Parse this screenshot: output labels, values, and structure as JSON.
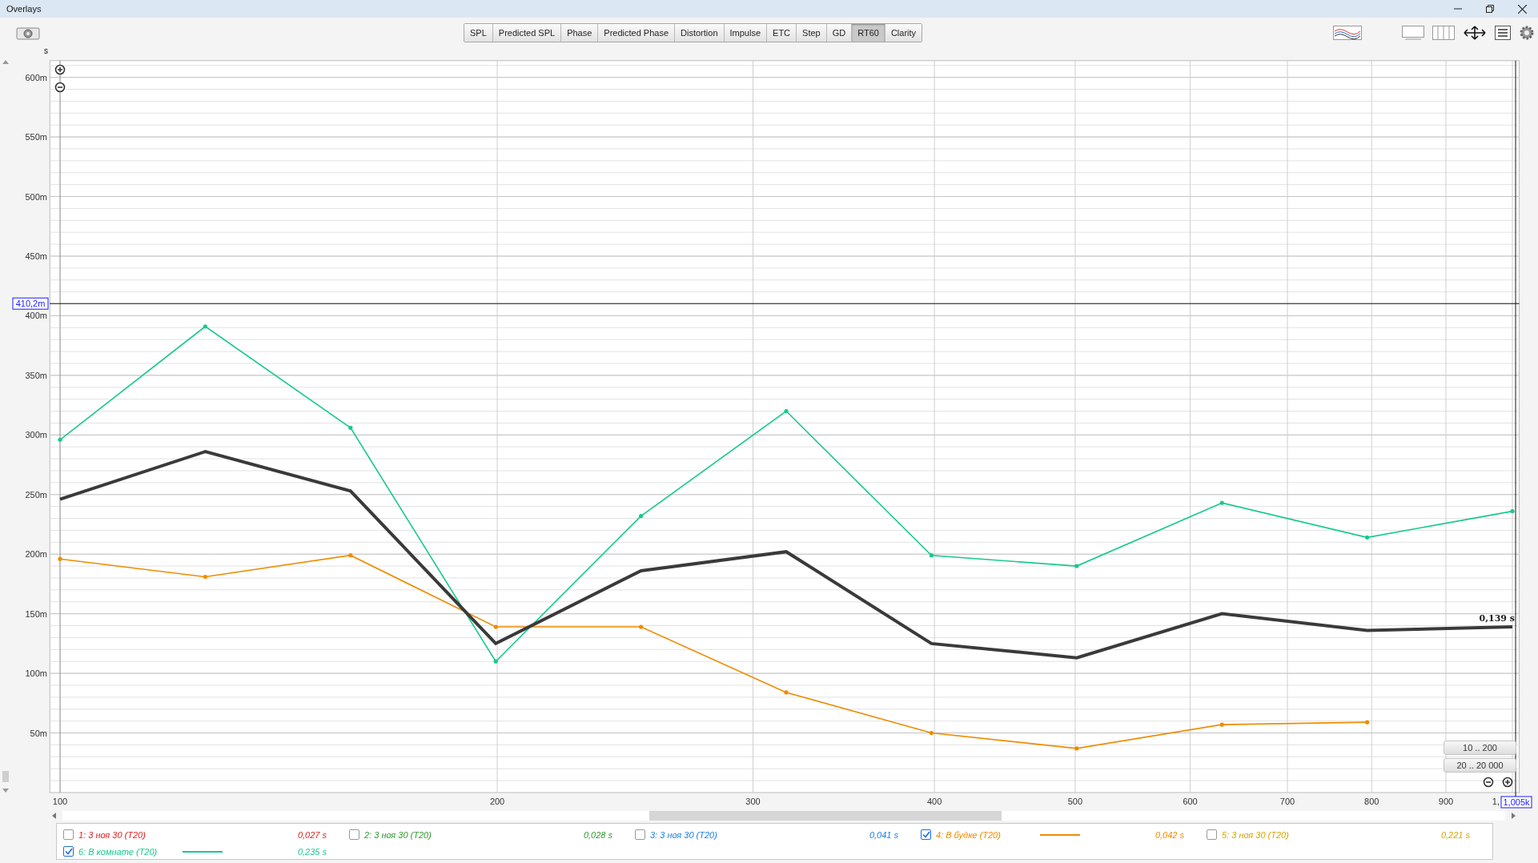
{
  "window": {
    "title": "Overlays"
  },
  "toolbar": {
    "tabs": [
      {
        "label": "SPL",
        "selected": false
      },
      {
        "label": "Predicted SPL",
        "selected": false
      },
      {
        "label": "Phase",
        "selected": false
      },
      {
        "label": "Predicted Phase",
        "selected": false
      },
      {
        "label": "Distortion",
        "selected": false
      },
      {
        "label": "Impulse",
        "selected": false
      },
      {
        "label": "ETC",
        "selected": false
      },
      {
        "label": "Step",
        "selected": false
      },
      {
        "label": "GD",
        "selected": false
      },
      {
        "label": "RT60",
        "selected": true
      },
      {
        "label": "Clarity",
        "selected": false
      }
    ]
  },
  "chart": {
    "unit_label": "s",
    "cursor_y_reading": "410,2m",
    "cursor_x_reading": "1,005k",
    "partial_x_label": "1,",
    "cursor_value": "0,139 s",
    "range_buttons": [
      "10 .. 200",
      "20 .. 20 000"
    ],
    "x_axis_labels": [
      "100",
      "200",
      "300",
      "400",
      "500",
      "600",
      "700",
      "800",
      "900"
    ],
    "chart_data": {
      "type": "line",
      "categories": [
        null,
        null,
        null,
        null,
        null,
        null,
        null,
        null,
        null,
        null,
        null
      ],
      "series": [
        {
          "color": "#17c98f",
          "values": [
            296,
            391,
            306,
            110,
            232,
            320,
            199,
            190,
            243,
            214,
            236
          ]
        },
        {
          "color": "#ef8c00",
          "values": [
            196,
            181,
            199,
            139,
            139,
            84,
            50,
            37,
            57,
            59,
            null
          ]
        },
        {
          "color": "#3a3a3a",
          "values": [
            246,
            286,
            253,
            125,
            186,
            202,
            125,
            113,
            150,
            136,
            139
          ]
        }
      ],
      "ylim": [
        0,
        614
      ],
      "grid": true,
      "ref_lines": [
        {
          "axis": "y",
          "value": 410.2
        }
      ],
      "yticks": [
        {
          "value": 50,
          "label": "50m"
        },
        {
          "value": 100,
          "label": "100m"
        },
        {
          "value": 150,
          "label": "150m"
        },
        {
          "value": 200,
          "label": "200m"
        },
        {
          "value": 250,
          "label": "250m"
        },
        {
          "value": 300,
          "label": "300m"
        },
        {
          "value": 350,
          "label": "350m"
        },
        {
          "value": 400,
          "label": "400m"
        },
        {
          "value": 450,
          "label": "450m"
        },
        {
          "value": 500,
          "label": "500m"
        },
        {
          "value": 550,
          "label": "550m"
        },
        {
          "value": 600,
          "label": "600m"
        }
      ]
    }
  },
  "legend": [
    {
      "label": "1: 3 ноя 30 (T20)",
      "value": "0,027 s",
      "checked": false,
      "color": "#e02020"
    },
    {
      "label": "2: 3 ноя 30 (T20)",
      "value": "0,028 s",
      "checked": false,
      "color": "#2e9a2e"
    },
    {
      "label": "3: 3 ноя 30 (T20)",
      "value": "0,041 s",
      "checked": false,
      "color": "#1e7ee8"
    },
    {
      "label": "4: В будке (T20)",
      "value": "0,042 s",
      "checked": true,
      "color": "#ef8c00"
    },
    {
      "label": "5: 3 ноя 30 (T20)",
      "value": "0,221 s",
      "checked": false,
      "color": "#d9a400"
    },
    {
      "label": "6: В комнате (T20)",
      "value": "0,235 s",
      "checked": true,
      "color": "#17c98f"
    }
  ]
}
